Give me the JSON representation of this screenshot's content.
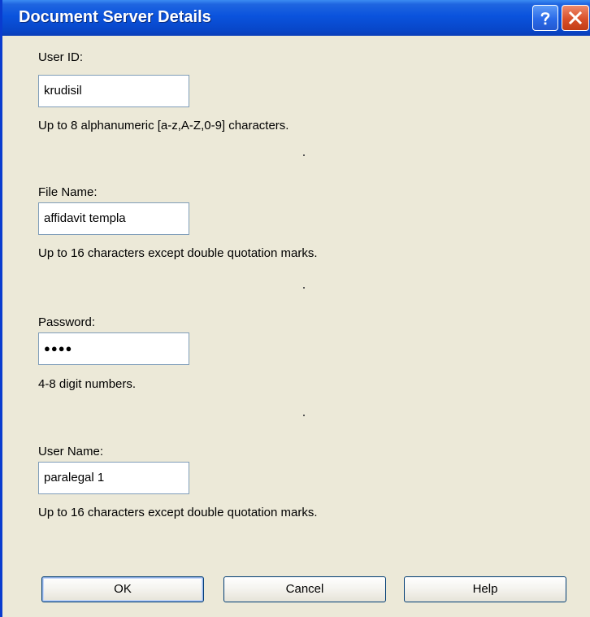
{
  "window": {
    "title": "Document Server Details"
  },
  "titlebar_buttons": {
    "help_glyph": "?",
    "close_glyph": "X",
    "help_icon": "help-icon",
    "close_icon": "close-icon"
  },
  "fields": {
    "user_id": {
      "label": "User ID:",
      "value": "krudisil",
      "hint": "Up to 8 alphanumeric [a-z,A-Z,0-9] characters."
    },
    "file_name": {
      "label": "File Name:",
      "value": "affidavit templa",
      "hint": "Up to 16 characters except double quotation marks."
    },
    "password": {
      "label": "Password:",
      "value": "●●●●",
      "hint": "4-8 digit numbers."
    },
    "user_name": {
      "label": "User Name:",
      "value": "paralegal 1",
      "hint": "Up to 16 characters except double quotation marks."
    }
  },
  "buttons": {
    "ok": "OK",
    "cancel": "Cancel",
    "help": "Help"
  },
  "colors": {
    "titlebar": "#0a53dd",
    "dialog_bg": "#ece9d8",
    "close_button": "#d9502a",
    "field_border": "#7f9db9"
  }
}
